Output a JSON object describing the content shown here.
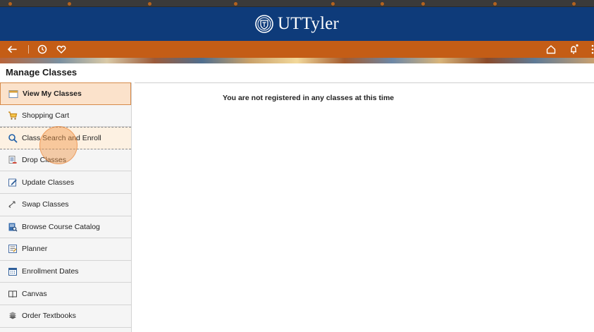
{
  "brand": {
    "name": "UTTyler"
  },
  "page": {
    "title": "Manage Classes"
  },
  "sidebar": {
    "items": [
      {
        "label": "View My Classes",
        "icon": "calendar-icon"
      },
      {
        "label": "Shopping Cart",
        "icon": "cart-icon"
      },
      {
        "label": "Class Search and Enroll",
        "icon": "search-icon"
      },
      {
        "label": "Drop Classes",
        "icon": "drop-list-icon"
      },
      {
        "label": "Update Classes",
        "icon": "edit-icon"
      },
      {
        "label": "Swap Classes",
        "icon": "swap-icon"
      },
      {
        "label": "Browse Course Catalog",
        "icon": "catalog-icon"
      },
      {
        "label": "Planner",
        "icon": "planner-icon"
      },
      {
        "label": "Enrollment Dates",
        "icon": "calendar-grid-icon"
      },
      {
        "label": "Canvas",
        "icon": "book-open-icon"
      },
      {
        "label": "Order Textbooks",
        "icon": "textbooks-icon"
      }
    ]
  },
  "main": {
    "message": "You are not registered in any classes at this time"
  },
  "colors": {
    "brand_blue": "#0e3b7a",
    "nav_orange": "#c45d16",
    "active_bg": "#fbe2cb"
  }
}
